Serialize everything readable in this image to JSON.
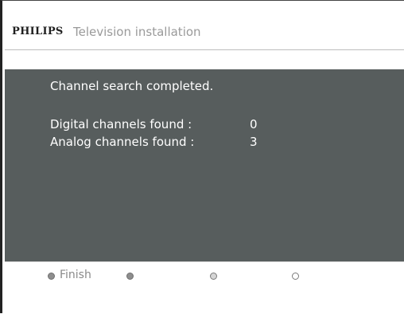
{
  "header": {
    "brand": "PHILIPS",
    "title": "Television installation"
  },
  "panel": {
    "status": "Channel search completed.",
    "rows": [
      {
        "label": "Digital channels found :",
        "value": "0"
      },
      {
        "label": "Analog channels found :",
        "value": "3"
      }
    ]
  },
  "footer": {
    "buttons": [
      {
        "icon": "red-key-dot-icon",
        "label": "Finish"
      },
      {
        "icon": "green-key-dot-icon",
        "label": ""
      },
      {
        "icon": "yellow-key-dot-icon",
        "label": ""
      },
      {
        "icon": "blue-key-dot-icon",
        "label": ""
      }
    ]
  },
  "colors": {
    "panel_background": "#575d5d",
    "brand_text": "#1f1f1f",
    "title_text": "#9a9a9a"
  }
}
